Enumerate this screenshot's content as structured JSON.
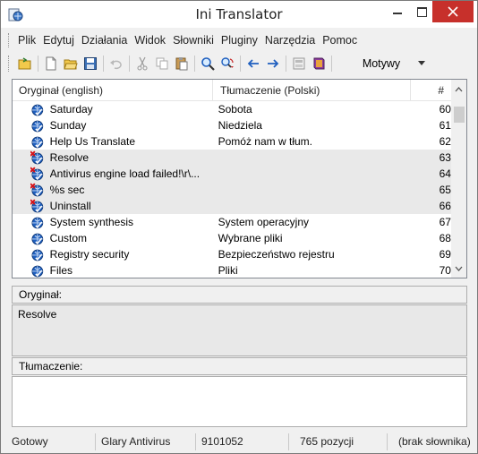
{
  "window": {
    "title": "Ini Translator"
  },
  "menu": [
    "Plik",
    "Edytuj",
    "Działania",
    "Widok",
    "Słowniki",
    "Pluginy",
    "Narzędzia",
    "Pomoc"
  ],
  "toolbar": {
    "theme_label": "Motywy"
  },
  "list": {
    "headers": {
      "original": "Oryginał (english)",
      "translation": "Tłumaczenie (Polski)",
      "number": "#"
    },
    "rows": [
      {
        "original": "Saturday",
        "translation": "Sobota",
        "number": "60",
        "status": "translated"
      },
      {
        "original": "Sunday",
        "translation": "Niedziela",
        "number": "61",
        "status": "translated"
      },
      {
        "original": "Help Us Translate",
        "translation": "Pomóż nam w tłum.",
        "number": "62",
        "status": "translated"
      },
      {
        "original": "Resolve",
        "translation": "",
        "number": "63",
        "status": "untranslated"
      },
      {
        "original": "Antivirus engine load failed!\\r\\...",
        "translation": "",
        "number": "64",
        "status": "untranslated"
      },
      {
        "original": "%s sec",
        "translation": "",
        "number": "65",
        "status": "untranslated"
      },
      {
        "original": "Uninstall",
        "translation": "",
        "number": "66",
        "status": "untranslated"
      },
      {
        "original": "System synthesis",
        "translation": "System operacyjny",
        "number": "67",
        "status": "translated"
      },
      {
        "original": "Custom",
        "translation": "Wybrane pliki",
        "number": "68",
        "status": "translated"
      },
      {
        "original": "Registry security",
        "translation": "Bezpieczeństwo rejestru",
        "number": "69",
        "status": "translated"
      },
      {
        "original": "Files",
        "translation": "Pliki",
        "number": "70",
        "status": "translated"
      }
    ]
  },
  "original_panel": {
    "label": "Oryginał:",
    "text": "Resolve"
  },
  "translation_panel": {
    "label": "Tłumaczenie:",
    "text": ""
  },
  "status": {
    "state": "Gotowy",
    "project": "Glary Antivirus",
    "id": "9101052",
    "count": "765 pozycji",
    "dictionary": "(brak słownika)"
  },
  "colors": {
    "close_button": "#c7302b",
    "untranslated_row": "#e9e9e9",
    "globe_blue": "#1f5fbf",
    "error_mark": "#d6141b"
  }
}
